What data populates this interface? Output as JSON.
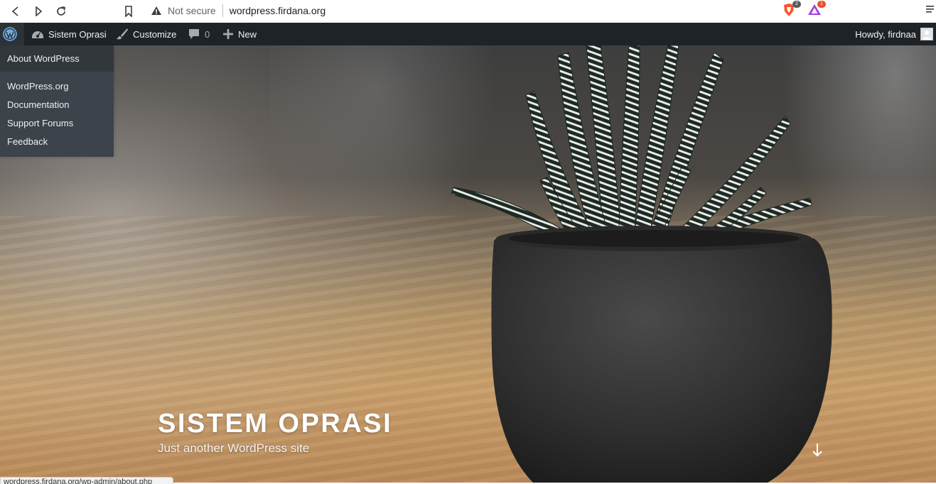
{
  "browser": {
    "security_label": "Not secure",
    "url": "wordpress.firdana.org",
    "icons": [
      "back-icon",
      "forward-icon",
      "reload-icon",
      "bookmark-icon",
      "warning-icon",
      "brave-shield-icon",
      "brave-rewards-icon",
      "menu-icon"
    ],
    "extensions": {
      "shield_badge": "2",
      "rewards_badge": "1"
    },
    "status_text": "wordpress.firdana.org/wp-admin/about.php"
  },
  "adminbar": {
    "site_name": "Sistem Oprasi",
    "customize_label": "Customize",
    "comments_count": "0",
    "new_label": "New",
    "howdy_label": "Howdy, firdnaa",
    "icons": [
      "wordpress-logo-icon",
      "dashboard-icon",
      "brush-icon",
      "comment-icon",
      "plus-icon",
      "avatar"
    ]
  },
  "wp_menu": {
    "about": "About WordPress",
    "links": [
      "WordPress.org",
      "Documentation",
      "Support Forums",
      "Feedback"
    ]
  },
  "hero": {
    "title": "SISTEM OPRASI",
    "tagline": "Just another WordPress site",
    "scroll_icon": "arrow-down-icon"
  },
  "colors": {
    "adminbar_bg": "#1d2327",
    "submenu_bg": "#3c434a",
    "wp_blue": "#72aee6"
  }
}
